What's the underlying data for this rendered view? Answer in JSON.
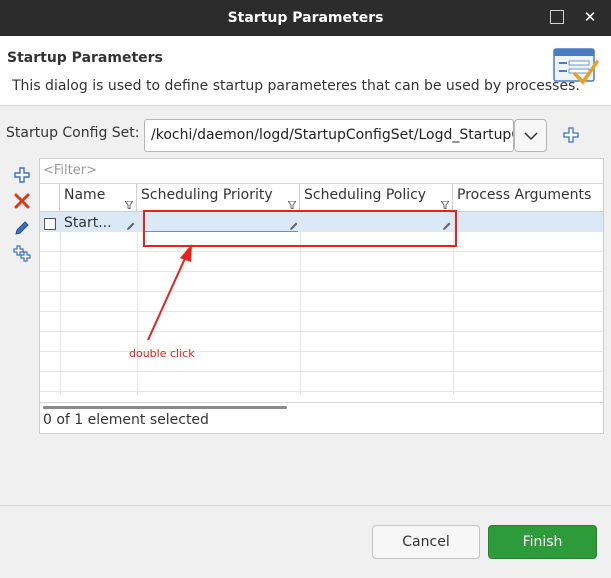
{
  "window": {
    "title": "Startup Parameters"
  },
  "header": {
    "title": "Startup Parameters",
    "description": "This dialog is used to define startup parameteres that can be used by processes."
  },
  "config_set": {
    "label": "Startup Config Set:",
    "value": "/kochi/daemon/logd/StartupConfigSet/Logd_StartupC"
  },
  "table": {
    "filter_placeholder": "<Filter>",
    "columns": [
      "Name",
      "Scheduling Priority",
      "Scheduling Policy",
      "Process Arguments"
    ],
    "rows": [
      {
        "name": "Start...",
        "scheduling_priority": "",
        "scheduling_policy": "",
        "process_arguments": ""
      }
    ],
    "status": "0 of 1 element selected"
  },
  "annotation": {
    "text": "double click",
    "color": "#e8211d"
  },
  "buttons": {
    "cancel": "Cancel",
    "finish": "Finish"
  },
  "colors": {
    "titlebar": "#2c2c2c",
    "accent_green": "#2d9b3a",
    "selection": "#dbe9f7"
  }
}
